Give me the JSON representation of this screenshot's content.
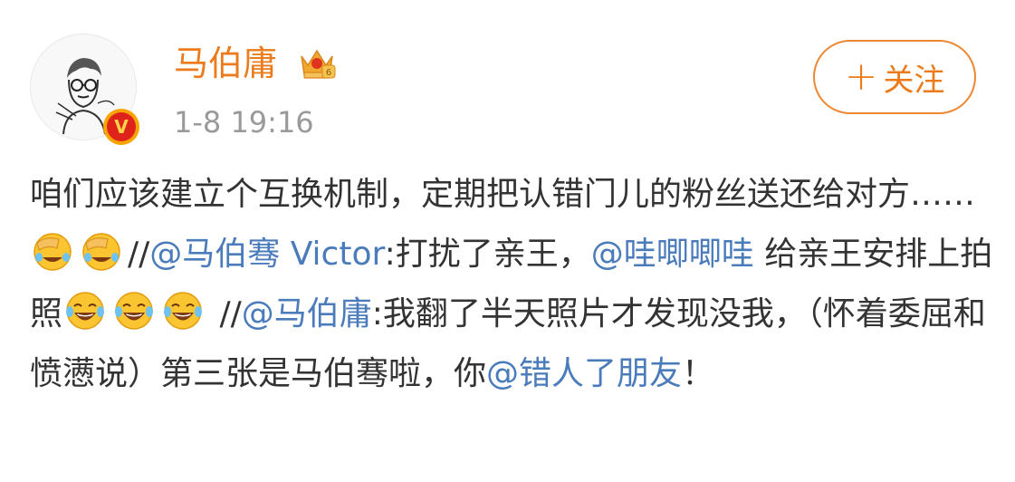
{
  "post": {
    "author": {
      "name": "马伯庸",
      "verified_badge": "V",
      "level_badge": "crown-icon"
    },
    "timestamp": "1-8 19:16",
    "follow_button": {
      "label": "关注",
      "icon": "plus-icon"
    },
    "content": {
      "p1": "咱们应该建立个互换机制，定期把认错门儿的粉丝送还给对方……",
      "sep1": "//",
      "m1": "@马伯骞 Victor",
      "p2": ":打扰了亲王，",
      "m2": "@哇唧唧哇",
      "p3": " 给亲王安排上拍照",
      "sep2": " //",
      "m3": "@马伯庸",
      "p4": ":我翻了半天照片才发现没我，（怀着委屈和愤懑说）第三张是马伯骞啦，你",
      "m4": "@错人了朋友",
      "p5": "！"
    },
    "emoji": {
      "facepalm": "facepalm-laugh-emoji",
      "laugh": "laugh-cry-emoji"
    }
  },
  "colors": {
    "username": "#eb7b1d",
    "mention": "#4a7bbb",
    "follow": "#ed7a18",
    "timestamp": "#9a9a9a",
    "text": "#333333"
  }
}
